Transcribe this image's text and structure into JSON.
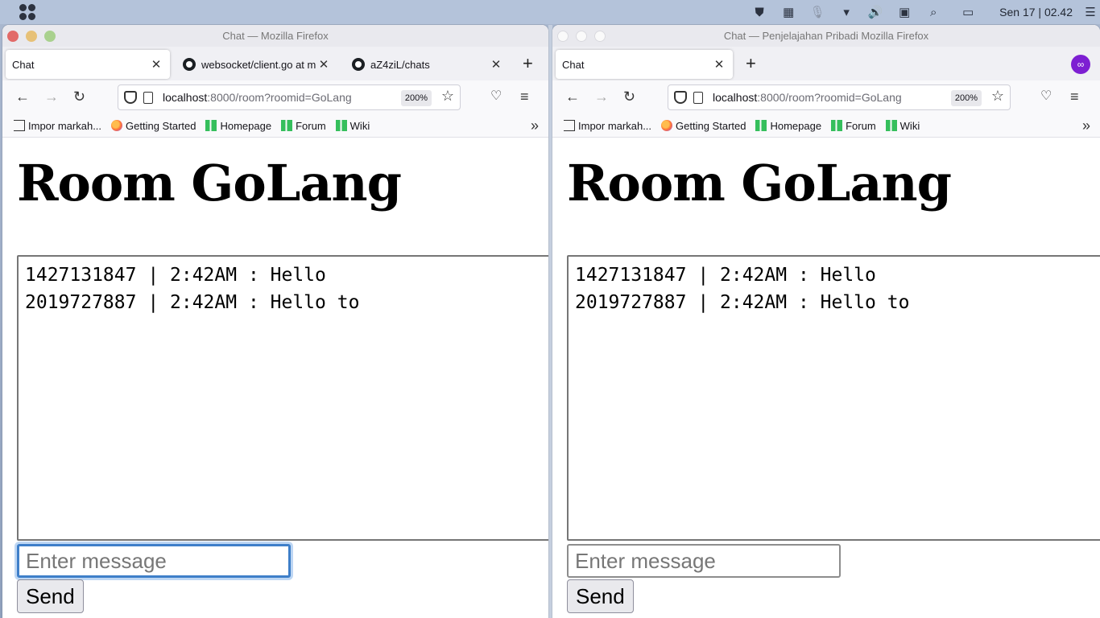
{
  "system": {
    "clock": "Sen 17 | 02.42",
    "tray_icons": [
      "shield-icon",
      "app-grid-icon",
      "mic-icon",
      "chevron-down-icon",
      "volume-icon",
      "screen-icon",
      "search-icon",
      "battery-icon",
      "settings-icon"
    ]
  },
  "left_window": {
    "title": "Chat — Mozilla Firefox",
    "tabs": [
      {
        "label": "Chat"
      },
      {
        "label": "websocket/client.go at ma"
      },
      {
        "label": "aZ4ziL/chats"
      }
    ],
    "url": {
      "host": "localhost",
      "path": ":8000/room?roomid=GoLang"
    },
    "zoom": "200%",
    "bookmarks": [
      "Impor markah...",
      "Getting Started",
      "Homepage",
      "Forum",
      "Wiki"
    ],
    "page": {
      "heading": "Room GoLang",
      "messages": [
        "1427131847 | 2:42AM : Hello",
        "2019727887 | 2:42AM : Hello to"
      ],
      "input_placeholder": "Enter message",
      "send_label": "Send"
    }
  },
  "right_window": {
    "title": "Chat — Penjelajahan Pribadi Mozilla Firefox",
    "tabs": [
      {
        "label": "Chat"
      }
    ],
    "url": {
      "host": "localhost",
      "path": ":8000/room?roomid=GoLang"
    },
    "zoom": "200%",
    "bookmarks": [
      "Impor markah...",
      "Getting Started",
      "Homepage",
      "Forum",
      "Wiki"
    ],
    "page": {
      "heading": "Room GoLang",
      "messages": [
        "1427131847 | 2:42AM : Hello",
        "2019727887 | 2:42AM : Hello to"
      ],
      "input_placeholder": "Enter message",
      "send_label": "Send"
    }
  }
}
